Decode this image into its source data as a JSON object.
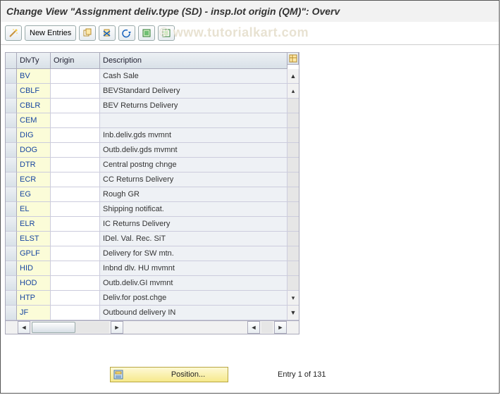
{
  "title": "Change View \"Assignment deliv.type (SD) - insp.lot origin (QM)\": Overv",
  "watermark": "www.tutorialkart.com",
  "toolbar": {
    "new_entries": "New Entries"
  },
  "table": {
    "columns": {
      "dlvty": "DlvTy",
      "origin": "Origin",
      "desc": "Description"
    },
    "rows": [
      {
        "dlvty": "BV",
        "origin": "",
        "desc": "Cash Sale"
      },
      {
        "dlvty": "CBLF",
        "origin": "",
        "desc": "BEVStandard Delivery"
      },
      {
        "dlvty": "CBLR",
        "origin": "",
        "desc": "BEV Returns Delivery"
      },
      {
        "dlvty": "CEM",
        "origin": "",
        "desc": ""
      },
      {
        "dlvty": "DIG",
        "origin": "",
        "desc": "Inb.deliv.gds mvmnt"
      },
      {
        "dlvty": "DOG",
        "origin": "",
        "desc": "Outb.deliv.gds mvmnt"
      },
      {
        "dlvty": "DTR",
        "origin": "",
        "desc": "Central postng chnge"
      },
      {
        "dlvty": "ECR",
        "origin": "",
        "desc": "CC Returns Delivery"
      },
      {
        "dlvty": "EG",
        "origin": "",
        "desc": "Rough GR"
      },
      {
        "dlvty": "EL",
        "origin": "",
        "desc": "Shipping notificat."
      },
      {
        "dlvty": "ELR",
        "origin": "",
        "desc": "IC Returns Delivery"
      },
      {
        "dlvty": "ELST",
        "origin": "",
        "desc": "IDel. Val. Rec. SiT"
      },
      {
        "dlvty": "GPLF",
        "origin": "",
        "desc": "Delivery for SW mtn."
      },
      {
        "dlvty": "HID",
        "origin": "",
        "desc": "Inbnd dlv. HU mvmnt"
      },
      {
        "dlvty": "HOD",
        "origin": "",
        "desc": "Outb.deliv.GI mvmnt"
      },
      {
        "dlvty": "HTP",
        "origin": "",
        "desc": "Deliv.for post.chge"
      },
      {
        "dlvty": "JF",
        "origin": "",
        "desc": "Outbound delivery IN"
      }
    ]
  },
  "footer": {
    "position_label": "Position...",
    "entry_info": "Entry 1 of 131"
  }
}
